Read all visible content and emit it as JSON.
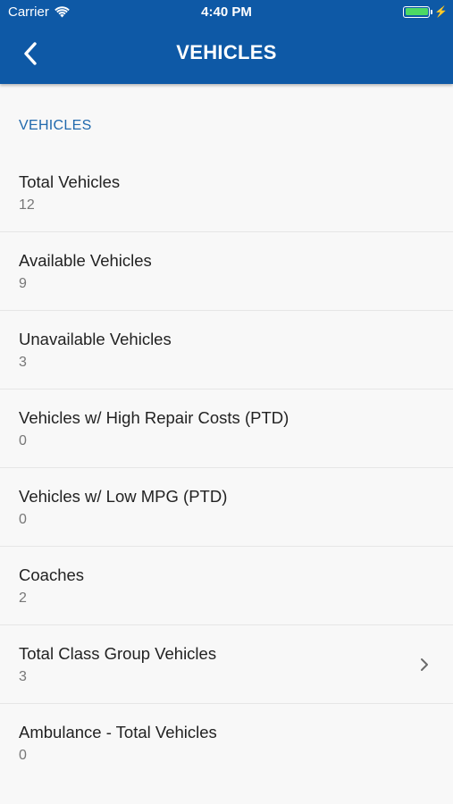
{
  "status_bar": {
    "carrier": "Carrier",
    "time": "4:40 PM",
    "battery_color": "#4cd964"
  },
  "nav": {
    "title": "VEHICLES",
    "back_icon": "chevron-left-icon",
    "background": "#0e59a6"
  },
  "section": {
    "header": "VEHICLES",
    "accent": "#2069ad"
  },
  "items": [
    {
      "label": "Total Vehicles",
      "value": "12"
    },
    {
      "label": "Available Vehicles",
      "value": "9"
    },
    {
      "label": "Unavailable Vehicles",
      "value": "3"
    },
    {
      "label": "Vehicles w/ High Repair Costs (PTD)",
      "value": "0"
    },
    {
      "label": "Vehicles w/ Low MPG (PTD)",
      "value": "0"
    },
    {
      "label": "Coaches",
      "value": "2"
    },
    {
      "label": "Total Class Group Vehicles",
      "value": "3",
      "icon": "chevron-right-icon"
    },
    {
      "label": "Ambulance - Total Vehicles",
      "value": "0"
    }
  ]
}
